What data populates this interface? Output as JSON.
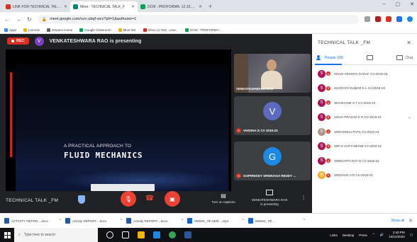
{
  "browser": {
    "tabs": [
      {
        "label": "LINK FOR TECHNICAL TALK_TSE",
        "color": "#d93025",
        "active": false
      },
      {
        "label": "Meet - TECHNICAL TALK_F",
        "color": "#00897b",
        "active": true
      },
      {
        "label": "DCM - PROFORMA- 12.10.2020",
        "color": "#0f9d58",
        "active": false
      }
    ],
    "new_tab": "+",
    "window_controls": [
      "–",
      "▢",
      "✕"
    ],
    "url": "meet.google.com/ozc-ubqf-wcv?pli=1&authuser=1",
    "bookmarks": [
      {
        "label": "Apps",
        "color": "#4285f4"
      },
      {
        "label": "journals",
        "color": "#f4b400"
      },
      {
        "label": "DSpace Home",
        "color": "#5f6368"
      },
      {
        "label": "Google Classroom",
        "color": "#0f9d58"
      },
      {
        "label": "Meet link",
        "color": "#f4b400"
      },
      {
        "label": "Inbox (4,753) - prav...",
        "color": "#d93025"
      },
      {
        "label": "DCM - PROFORMA-...",
        "color": "#0f9d58"
      }
    ]
  },
  "meet": {
    "rec_label": "REC",
    "presenter_initial": "V",
    "presenter_text": "VENKATESHWARA RAO is presenting",
    "slide": {
      "subtitle": "A PRACTICAL APPROACH TO",
      "title": "FLUID MECHANICS"
    },
    "tiles": [
      {
        "name": "VENKATESHWARA RAO",
        "initial": "",
        "color": "#5b4a3c"
      },
      {
        "name": "VARSHA G CV 2019-23",
        "initial": "V",
        "color": "#5c6bc0"
      },
      {
        "name": "GOPIREDDY SRINIVASA REDDY ...",
        "initial": "G",
        "color": "#1e88e5"
      }
    ],
    "controls": {
      "meeting_name": "TECHNICAL TALK _FM",
      "turn_on_captions": "Turn on captions",
      "presenting_line1": "VENKATESHWARA RAO",
      "presenting_line2": "is presenting",
      "more": "⋮"
    }
  },
  "panel": {
    "title": "TECHNICAL TALK _FM",
    "close": "✕",
    "tab_people": "People (39)",
    "tab_chat": "Chat",
    "participants": [
      {
        "name": "SHAIK ARSHIYA SADAF CV-2019-23",
        "initial": "S",
        "color": "#ad1457"
      },
      {
        "name": "SHARATH KUMAR K L CV-2019-23",
        "initial": "S",
        "color": "#ad1457"
      },
      {
        "name": "SHASHANK S T CV-2019-23",
        "initial": "S",
        "color": "#ad1457"
      },
      {
        "name": "SHIVA PRASAD K R CV-2019-23",
        "initial": "S",
        "color": "#ad1457"
      },
      {
        "name": "SHRADDHA PATIL CV-2019-23",
        "initial": "S",
        "color": "#b0948a"
      },
      {
        "name": "SIRI K GATTAMANE CV-2018-22",
        "initial": "S",
        "color": "#ad1457"
      },
      {
        "name": "SREEJITTA RAY N CV-2019-23",
        "initial": "S",
        "color": "#ad1457"
      },
      {
        "name": "SRIDHAR H R CV-2019-23",
        "initial": "😎",
        "color": "#f9a825"
      }
    ]
  },
  "downloads": {
    "items": [
      "ACTIVITY REPOR....docx",
      "Activity REPORT....docx",
      "Activity REPORT....docx",
      "MWMS_7th SEM ...mp4",
      "MWMS_7th ..."
    ],
    "show_all": "Show all",
    "close": "✕"
  },
  "taskbar": {
    "search_placeholder": "Type here to search",
    "tray_links": "Links",
    "tray_desktop": "Desktop",
    "tray_press": "Press",
    "time": "2:40 PM",
    "date": "10/12/2020"
  }
}
